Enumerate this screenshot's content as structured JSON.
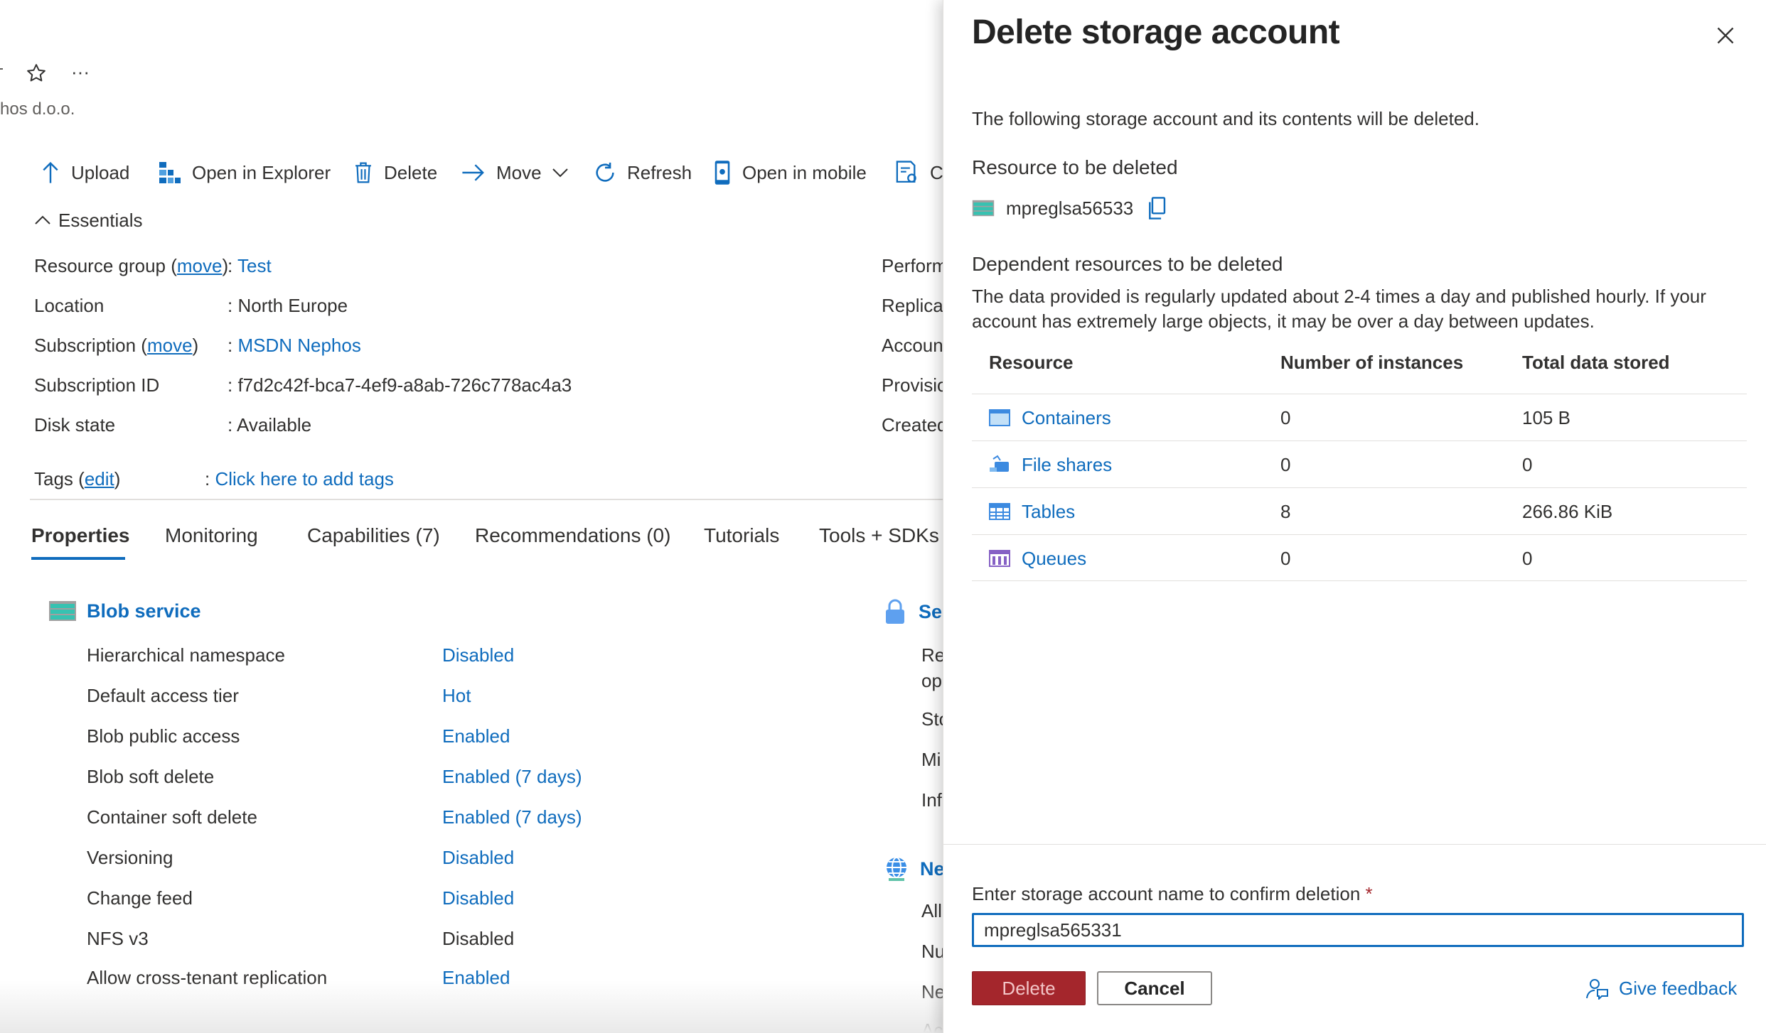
{
  "header": {
    "org_fragment": "hos d.o.o.",
    "more_label": "···"
  },
  "toolbar": {
    "upload": "Upload",
    "open_explorer": "Open in Explorer",
    "delete": "Delete",
    "move": "Move",
    "refresh": "Refresh",
    "open_mobile": "Open in mobile",
    "last_fragment": "C"
  },
  "essentials": {
    "toggle_label": "Essentials",
    "resource_group_label": "Resource group",
    "resource_group_move": "move",
    "resource_group_value": "Test",
    "location_label": "Location",
    "location_value": "North Europe",
    "subscription_label": "Subscription",
    "subscription_move": "move",
    "subscription_value": "MSDN Nephos",
    "subscription_id_label": "Subscription ID",
    "subscription_id_value": "f7d2c42f-bca7-4ef9-a8ab-726c778ac4a3",
    "disk_state_label": "Disk state",
    "disk_state_value": "Available",
    "tags_label": "Tags",
    "tags_edit": "edit",
    "tags_value": "Click here to add tags",
    "right_labels": [
      "Perform",
      "Replicat",
      "Accoun",
      "Provisio",
      "Created"
    ]
  },
  "tabs": [
    {
      "label": "Properties"
    },
    {
      "label": "Monitoring"
    },
    {
      "label": "Capabilities (7)"
    },
    {
      "label": "Recommendations (0)"
    },
    {
      "label": "Tutorials"
    },
    {
      "label": "Tools + SDKs"
    }
  ],
  "blob_service": {
    "title": "Blob service",
    "rows": [
      {
        "label": "Hierarchical namespace",
        "value": "Disabled"
      },
      {
        "label": "Default access tier",
        "value": "Hot"
      },
      {
        "label": "Blob public access",
        "value": "Enabled"
      },
      {
        "label": "Blob soft delete",
        "value": "Enabled (7 days)"
      },
      {
        "label": "Container soft delete",
        "value": "Enabled (7 days)"
      },
      {
        "label": "Versioning",
        "value": "Disabled"
      },
      {
        "label": "Change feed",
        "value": "Disabled"
      },
      {
        "label": "NFS v3",
        "value": "Disabled"
      },
      {
        "label": "Allow cross-tenant replication",
        "value": "Enabled"
      }
    ]
  },
  "security_fragment": {
    "title": "Se",
    "lines": [
      "Re",
      "op",
      "Sto",
      "Mi",
      "Inf"
    ]
  },
  "network_fragment": {
    "title": "Ne",
    "lines": [
      "All",
      "Nu",
      "Ne",
      "Ac"
    ]
  },
  "panel": {
    "title": "Delete storage account",
    "intro": "The following storage account and its contents will be deleted.",
    "resource_heading": "Resource to be deleted",
    "resource_name": "mpreglsa56533",
    "dependent_heading": "Dependent resources to be deleted",
    "dependent_desc_1": "The data provided is regularly updated about 2-4 times a day and published hourly. If your",
    "dependent_desc_2": "account has extremely large objects, it may be over a day between updates.",
    "table": {
      "headers": [
        "Resource",
        "Number of instances",
        "Total data stored"
      ],
      "rows": [
        {
          "resource": "Containers",
          "instances": "0",
          "stored": "105 B"
        },
        {
          "resource": "File shares",
          "instances": "0",
          "stored": "0"
        },
        {
          "resource": "Tables",
          "instances": "8",
          "stored": "266.86 KiB"
        },
        {
          "resource": "Queues",
          "instances": "0",
          "stored": "0"
        }
      ]
    },
    "confirm_label": "Enter storage account name to confirm deletion",
    "required_mark": "*",
    "confirm_value": "mpreglsa565331",
    "delete_button": "Delete",
    "cancel_button": "Cancel",
    "feedback_link": "Give feedback"
  }
}
